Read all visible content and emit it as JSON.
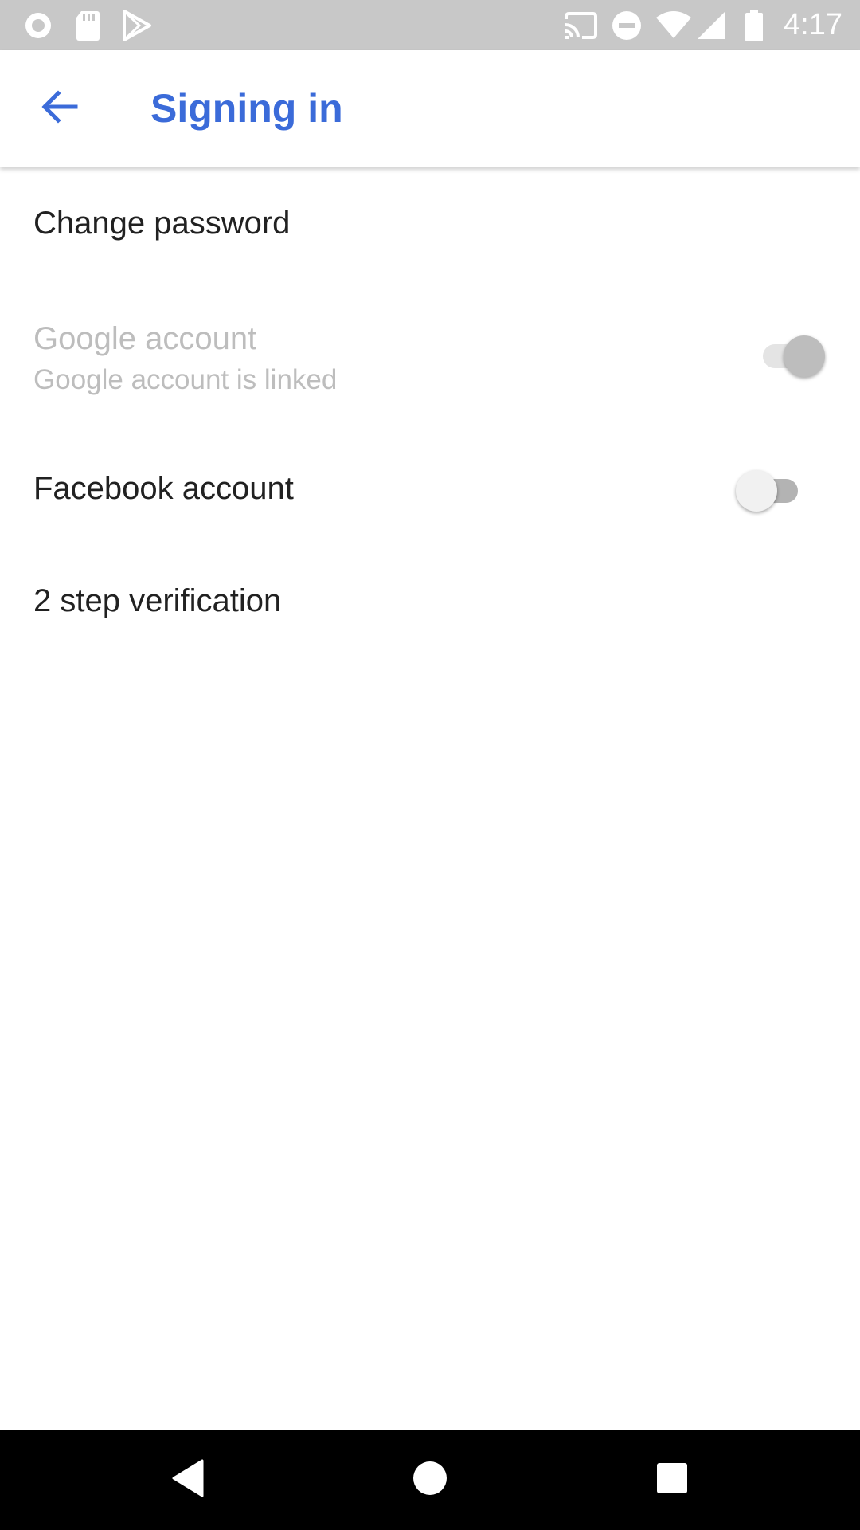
{
  "status_bar": {
    "time": "4:17",
    "left_icons": [
      "record-icon",
      "sd-card-icon",
      "play-store-icon"
    ],
    "right_icons": [
      "cast-icon",
      "do-not-disturb-icon",
      "wifi-icon",
      "signal-icon",
      "battery-icon"
    ]
  },
  "app_bar": {
    "title": "Signing in",
    "back_icon": "arrow-back-icon"
  },
  "settings": {
    "change_password": {
      "title": "Change password"
    },
    "google_account": {
      "title": "Google account",
      "subtitle": "Google account is linked",
      "enabled": false,
      "checked": true
    },
    "facebook_account": {
      "title": "Facebook account",
      "enabled": true,
      "checked": false
    },
    "two_step": {
      "title": "2 step verification"
    }
  },
  "nav_bar": {
    "buttons": [
      "back-triangle-icon",
      "home-circle-icon",
      "recents-square-icon"
    ]
  },
  "colors": {
    "accent": "#3b6bd9",
    "status_bar": "#c8c8c8",
    "text_primary": "#212121",
    "text_disabled": "#bdbdbd"
  }
}
